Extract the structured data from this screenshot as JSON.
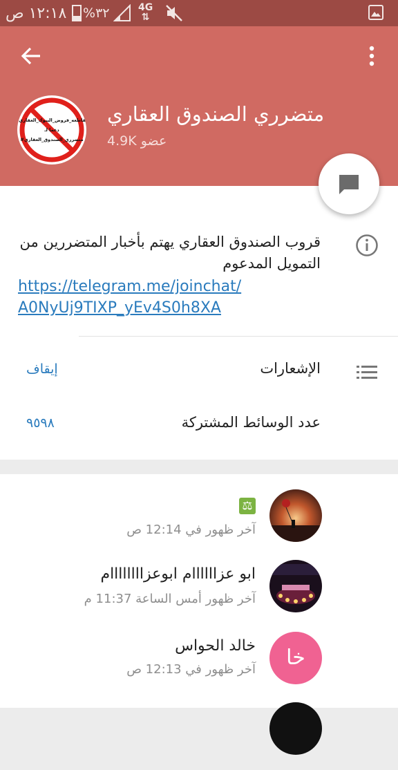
{
  "status_bar": {
    "time": "١٢:١٨ ص",
    "battery": "%٣٢",
    "battery_level": 0.32,
    "network": "4G",
    "icons": [
      "signal-icon",
      "mute-icon",
      "gallery-icon"
    ]
  },
  "header": {
    "group_title": "متضرري الصندوق العقاري",
    "member_count": "4.9K عضو",
    "avatar_text": [
      "#مقاطعه_قروض_البنوك_العقاري",
      "دعما لـ",
      "#متضرري_الصندوق_العقاري"
    ],
    "background": "#d06a62"
  },
  "info": {
    "description": "قروب الصندوق العقاري يهتم بأخبار المتضررين من التمويل المدعوم",
    "link_line1": "https://telegram.me/joinchat/",
    "link_line2": "A0NyUj9TIXP_yEv4S0h8XA",
    "notifications_label": "الإشعارات",
    "notifications_value": "إيقاف",
    "shared_media_label": "عدد الوسائط المشتركة",
    "shared_media_value": "٩٥٩٨"
  },
  "members": [
    {
      "name": "",
      "emoji_icon": "scale-icon",
      "last_seen": "آخر ظهور في 12:14 ص"
    },
    {
      "name": "ابو عزاااااام ابوعزاااااااام",
      "last_seen": "آخر ظهور أمس الساعة 11:37 م"
    },
    {
      "name": "خالد الحواس",
      "last_seen": "آخر ظهور في 12:13 ص",
      "initials": "خا",
      "avatar_color": "#f06292"
    }
  ]
}
